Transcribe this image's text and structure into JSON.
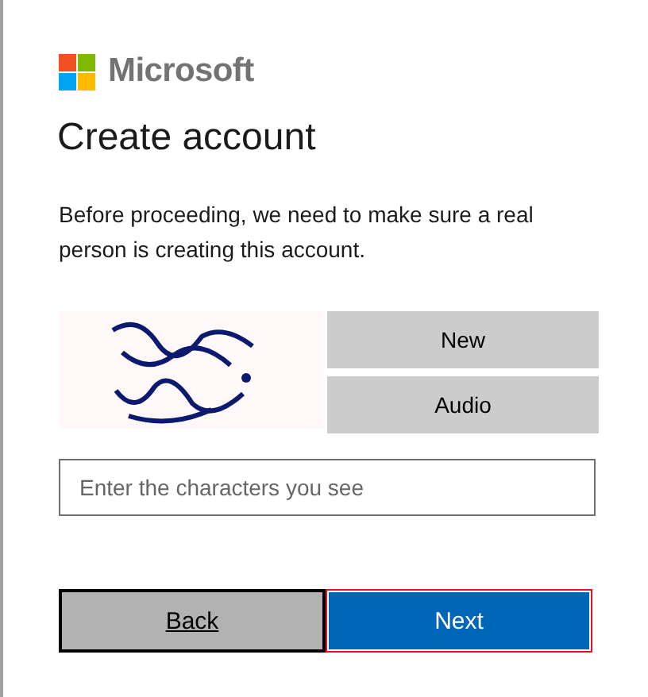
{
  "logo": {
    "name": "Microsoft"
  },
  "title": "Create account",
  "description": "Before proceeding, we need to make sure a real person is creating this account.",
  "captcha": {
    "kind": "picture",
    "buttons": [
      "New",
      "Audio"
    ]
  },
  "input": {
    "placeholder": "Enter the characters you see"
  },
  "actions": [
    {
      "label": "Back",
      "kind": "secondary"
    },
    {
      "label": "Next",
      "kind": "primary"
    }
  ]
}
